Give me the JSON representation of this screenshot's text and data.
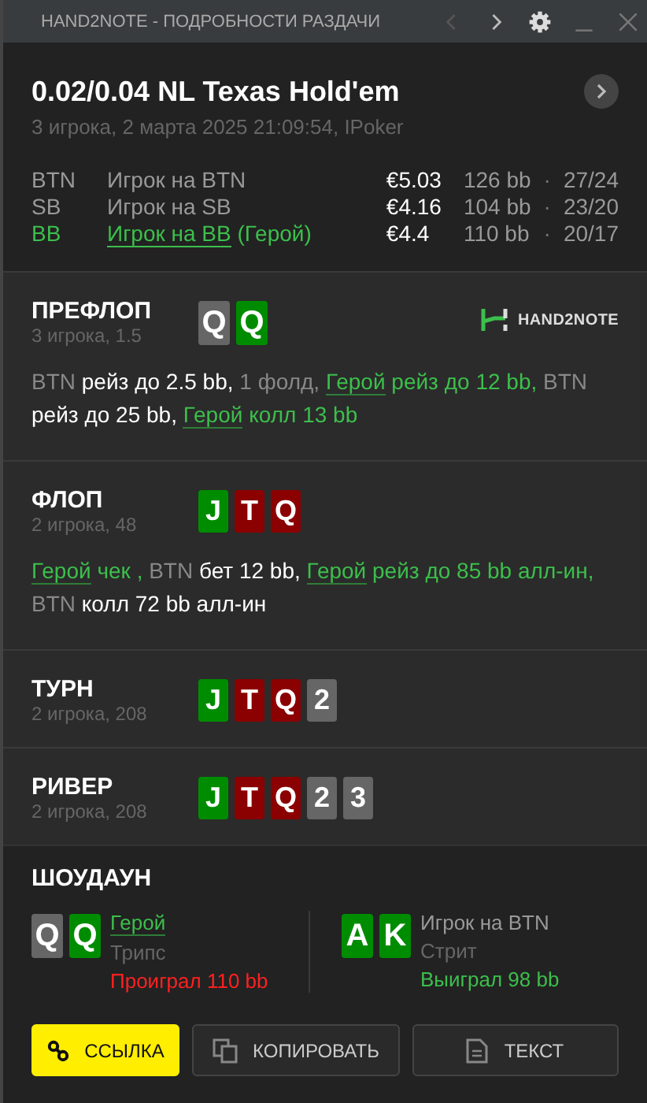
{
  "window": {
    "title": "HAND2NOTE - ПОДРОБНОСТИ РАЗДАЧИ"
  },
  "hand": {
    "title": "0.02/0.04 NL Texas Hold'em",
    "subtitle": "3 игрока, 2 марта 2025 21:09:54, IPoker"
  },
  "players": [
    {
      "position": "BTN",
      "name": "Игрок на BTN",
      "hero": false,
      "stack": "€5.03",
      "bb": "126 bb",
      "separator": "·",
      "stat": "27/24"
    },
    {
      "position": "SB",
      "name": "Игрок на SB",
      "hero": false,
      "stack": "€4.16",
      "bb": "104 bb",
      "separator": "·",
      "stat": "23/20"
    },
    {
      "position": "BB",
      "name": "Игрок на BB",
      "hero": true,
      "hero_tag": "(Герой)",
      "stack": "€4.4",
      "bb": "110 bb",
      "separator": "·",
      "stat": "20/17"
    }
  ],
  "streets": [
    {
      "name": "ПРЕФЛОП",
      "info": "3 игрока, 1.5",
      "logo": "HAND2NOTE",
      "cards": [
        {
          "rank": "Q",
          "color": "#666666"
        },
        {
          "rank": "Q",
          "color": "#008c00"
        }
      ],
      "actions": [
        {
          "kind": "name",
          "text": "BTN"
        },
        {
          "kind": "act",
          "text": "рейз до 2.5 bb,"
        },
        {
          "kind": "muted",
          "text": "1 фолд,"
        },
        {
          "kind": "hero",
          "text": "Герой"
        },
        {
          "kind": "hero-act",
          "text": "рейз до 12 bb,"
        },
        {
          "kind": "name",
          "text": "BTN"
        },
        {
          "kind": "act",
          "text": "рейз до 25 bb,"
        },
        {
          "kind": "hero",
          "text": "Герой"
        },
        {
          "kind": "hero-act",
          "text": "колл 13 bb"
        }
      ]
    },
    {
      "name": "ФЛОП",
      "info": "2 игрока, 48",
      "cards": [
        {
          "rank": "J",
          "color": "#008c00"
        },
        {
          "rank": "T",
          "color": "#8b0000"
        },
        {
          "rank": "Q",
          "color": "#8b0000"
        }
      ],
      "actions": [
        {
          "kind": "hero",
          "text": "Герой"
        },
        {
          "kind": "hero-act",
          "text": "чек ,"
        },
        {
          "kind": "name",
          "text": "BTN"
        },
        {
          "kind": "act",
          "text": "бет 12 bb,"
        },
        {
          "kind": "hero",
          "text": "Герой"
        },
        {
          "kind": "hero-act",
          "text": "рейз до 85 bb алл-ин,"
        },
        {
          "kind": "name",
          "text": "BTN"
        },
        {
          "kind": "act",
          "text": "колл 72 bb алл-ин"
        }
      ]
    },
    {
      "name": "ТУРН",
      "info": "2 игрока, 208",
      "cards": [
        {
          "rank": "J",
          "color": "#008c00"
        },
        {
          "rank": "T",
          "color": "#8b0000"
        },
        {
          "rank": "Q",
          "color": "#8b0000"
        },
        {
          "rank": "2",
          "color": "#666666"
        }
      ]
    },
    {
      "name": "РИВЕР",
      "info": "2 игрока, 208",
      "cards": [
        {
          "rank": "J",
          "color": "#008c00"
        },
        {
          "rank": "T",
          "color": "#8b0000"
        },
        {
          "rank": "Q",
          "color": "#8b0000"
        },
        {
          "rank": "2",
          "color": "#666666"
        },
        {
          "rank": "3",
          "color": "#666666"
        }
      ]
    }
  ],
  "showdown": {
    "title": "ШОУДАУН",
    "players": [
      {
        "name": "Герой",
        "hero": true,
        "hand": "Трипс",
        "result": "Проиграл 110 bb",
        "won": false,
        "cards": [
          {
            "rank": "Q",
            "color": "#666666"
          },
          {
            "rank": "Q",
            "color": "#008c00"
          }
        ]
      },
      {
        "name": "Игрок на BTN",
        "hero": false,
        "hand": "Стрит",
        "result": "Выиграл 98 bb",
        "won": true,
        "cards": [
          {
            "rank": "A",
            "color": "#008c00"
          },
          {
            "rank": "K",
            "color": "#008c00"
          }
        ]
      }
    ]
  },
  "buttons": [
    {
      "kind": "link",
      "label": "ССЫЛКА",
      "primary": true
    },
    {
      "kind": "copy",
      "label": "КОПИРОВАТЬ",
      "primary": false
    },
    {
      "kind": "text",
      "label": "ТЕКСТ",
      "primary": false
    }
  ]
}
